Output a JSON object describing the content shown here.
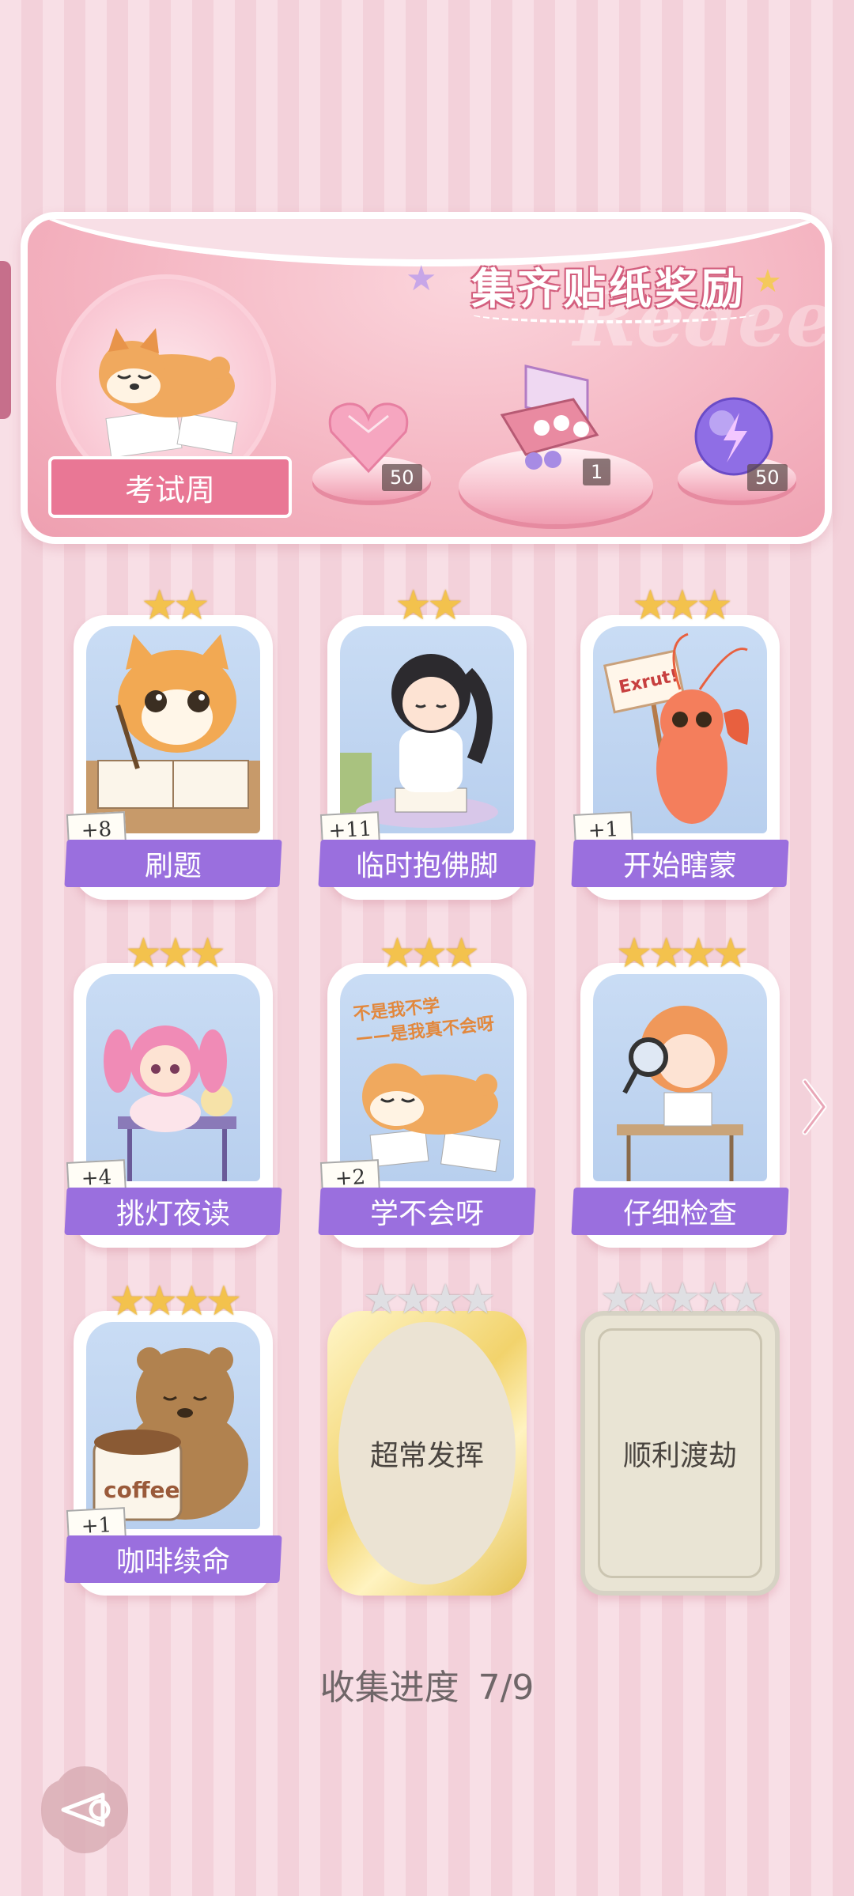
{
  "banner": {
    "title": "集齐贴纸奖励",
    "watermark": "Redeem",
    "theme_name": "考试周",
    "rewards": [
      {
        "item": "pink-heart-gem",
        "count": "50"
      },
      {
        "item": "gift-box",
        "count": "1"
      },
      {
        "item": "purple-energy-orb",
        "count": "50"
      }
    ]
  },
  "stickers": [
    {
      "name": "刷题",
      "stars": 2,
      "max_stars": 2,
      "bonus": "+8",
      "collected": true,
      "art": "cat-writing"
    },
    {
      "name": "临时抱佛脚",
      "stars": 2,
      "max_stars": 2,
      "bonus": "+11",
      "collected": true,
      "art": "girl-reading",
      "art_caption": ""
    },
    {
      "name": "开始瞎蒙",
      "stars": 3,
      "max_stars": 3,
      "bonus": "+1",
      "collected": true,
      "art": "shrimp-sign",
      "art_caption": "Exrut!"
    },
    {
      "name": "挑灯夜读",
      "stars": 3,
      "max_stars": 3,
      "bonus": "+4",
      "collected": true,
      "art": "girl-desk-lamp"
    },
    {
      "name": "学不会呀",
      "stars": 3,
      "max_stars": 3,
      "bonus": "+2",
      "collected": true,
      "art": "shiba-lying",
      "art_caption": "不是我不学\n——是我真不会呀"
    },
    {
      "name": "仔细检查",
      "stars": 4,
      "max_stars": 4,
      "bonus": "",
      "collected": true,
      "art": "girl-magnifier"
    },
    {
      "name": "咖啡续命",
      "stars": 4,
      "max_stars": 4,
      "bonus": "+1",
      "collected": true,
      "art": "bear-coffee",
      "art_caption": "coffee"
    },
    {
      "name": "超常发挥",
      "stars": 0,
      "max_stars": 4,
      "bonus": "",
      "collected": false
    },
    {
      "name": "顺利渡劫",
      "stars": 0,
      "max_stars": 5,
      "bonus": "",
      "collected": false
    }
  ],
  "progress": {
    "label": "收集进度",
    "value": "7/9"
  },
  "colors": {
    "label_purple": "#9a6fde",
    "star_gold": "#f3c24d",
    "background": "#f8dfe6",
    "banner_pink": "#f4b3c0"
  }
}
